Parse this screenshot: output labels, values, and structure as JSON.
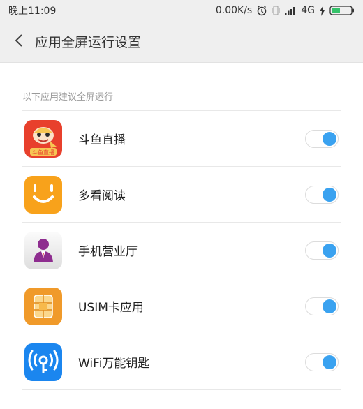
{
  "status_bar": {
    "time": "晚上11:09",
    "net_speed": "0.00K/s",
    "network_type": "4G",
    "icons": [
      "alarm-icon",
      "vibrate-icon",
      "signal-icon",
      "charging-icon",
      "battery-icon"
    ]
  },
  "header": {
    "back_icon": "chevron-left-icon",
    "title": "应用全屏运行设置"
  },
  "section": {
    "title": "以下应用建议全屏运行"
  },
  "apps": [
    {
      "name": "斗鱼直播",
      "icon": "douyu-icon",
      "enabled": true,
      "icon_caption": "斗鱼直播"
    },
    {
      "name": "多看阅读",
      "icon": "duokan-icon",
      "enabled": true
    },
    {
      "name": "手机营业厅",
      "icon": "business-hall-icon",
      "enabled": true
    },
    {
      "name": "USIM卡应用",
      "icon": "sim-card-icon",
      "enabled": true
    },
    {
      "name": "WiFi万能钥匙",
      "icon": "wifi-key-icon",
      "enabled": true
    }
  ],
  "colors": {
    "toggle_on": "#3aa2f0",
    "douyu": "#e8402c",
    "duokan": "#f8a21b",
    "sim": "#f09a2a",
    "wifi": "#1b86ef"
  }
}
